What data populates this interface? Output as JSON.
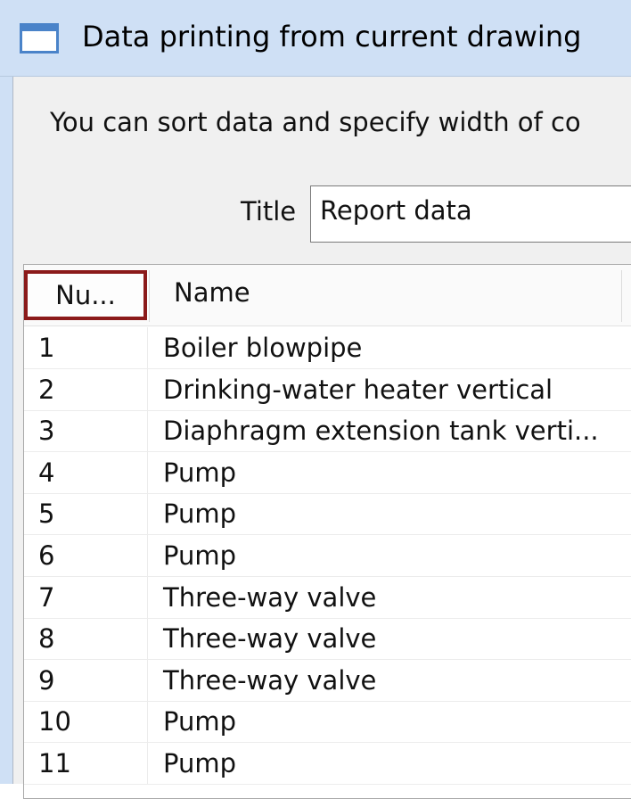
{
  "window": {
    "title": "Data printing from current drawing"
  },
  "dialog": {
    "description": "You can sort data and specify width of co",
    "title_label": "Title",
    "title_value": "Report data"
  },
  "table": {
    "columns": [
      "Nu...",
      "Name"
    ],
    "rows": [
      {
        "num": "1",
        "name": "Boiler blowpipe"
      },
      {
        "num": "2",
        "name": "Drinking-water heater vertical"
      },
      {
        "num": "3",
        "name": "Diaphragm extension tank verti..."
      },
      {
        "num": "4",
        "name": "Pump"
      },
      {
        "num": "5",
        "name": "Pump"
      },
      {
        "num": "6",
        "name": "Pump"
      },
      {
        "num": "7",
        "name": "Three-way valve"
      },
      {
        "num": "8",
        "name": "Three-way valve"
      },
      {
        "num": "9",
        "name": "Three-way valve"
      },
      {
        "num": "10",
        "name": "Pump"
      },
      {
        "num": "11",
        "name": "Pump"
      }
    ]
  }
}
